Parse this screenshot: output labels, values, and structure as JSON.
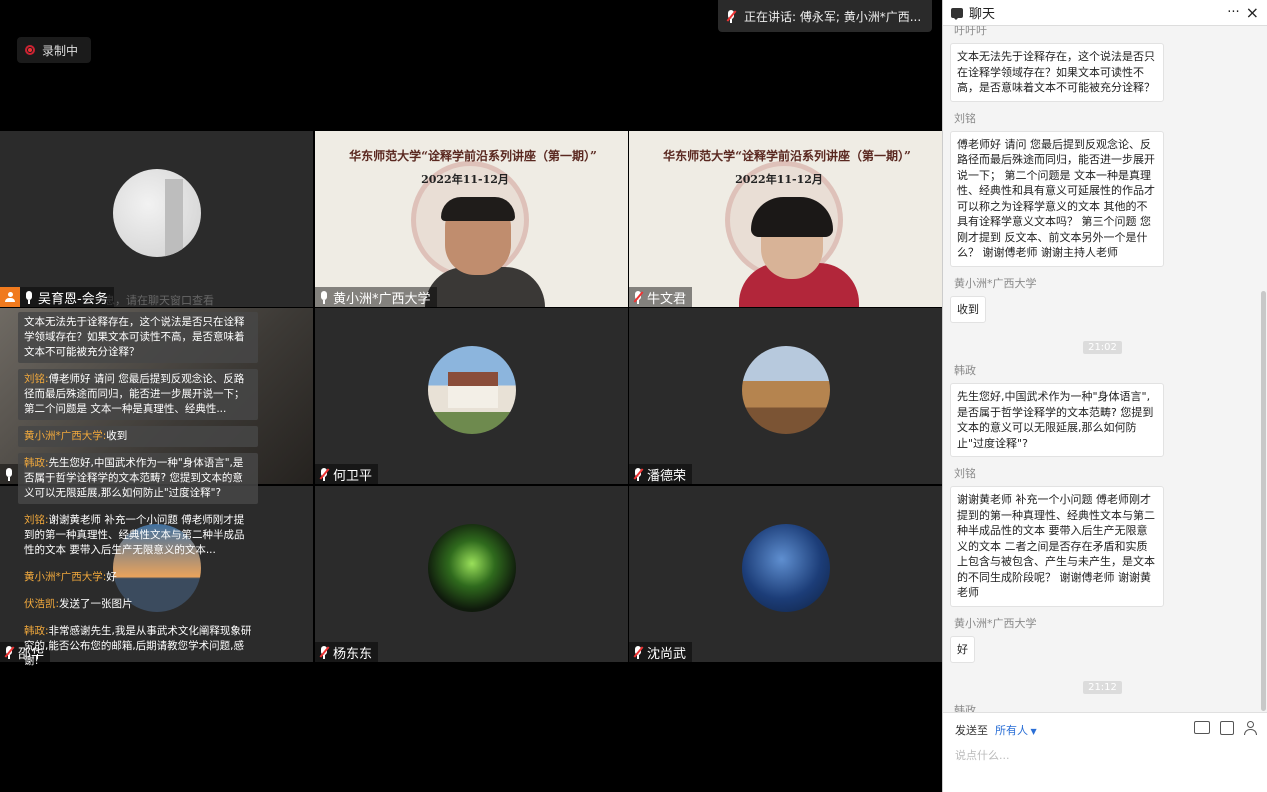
{
  "recording": {
    "label": "录制中"
  },
  "speaking": {
    "label": "正在讲话: 傅永军; 黄小洲*广西..."
  },
  "tiles": [
    {
      "name": "吴育恩-会务",
      "mic": "on",
      "host": true
    },
    {
      "name": "黄小洲*广西大学",
      "mic": "on"
    },
    {
      "name": "牛文君",
      "mic": "off"
    },
    {
      "name": "",
      "mic": "on"
    },
    {
      "name": "何卫平",
      "mic": "off"
    },
    {
      "name": "潘德荣",
      "mic": "off"
    },
    {
      "name": "邵华",
      "mic": "off"
    },
    {
      "name": "杨东东",
      "mic": "off"
    },
    {
      "name": "沈尚武",
      "mic": "off"
    }
  ],
  "slide": {
    "title": "华东师范大学“诠释学前沿系列讲座（第一期）”",
    "date": "2022年11-12月"
  },
  "tile1_hint": "息，请在聊天窗口查看",
  "overlay": [
    {
      "name": "",
      "text": "文本无法先于诠释存在，这个说法是否只在诠释学领域存在？如果文本可读性不高，是否意味着文本不可能被充分诠释？"
    },
    {
      "name": "刘铭:",
      "text": "傅老师好  请问 您最后提到反观念论、反路径而最后殊途而同归，能否进一步展开说一下；第二个问题是  文本一种是真理性、经典性..."
    },
    {
      "name": "黄小洲*广西大学:",
      "text": "收到"
    },
    {
      "name": "韩政:",
      "text": "先生您好,中国武术作为一种\"身体语言\",是否属于哲学诠释学的文本范畴? 您提到文本的意义可以无限延展,那么如何防止\"过度诠释\"?"
    },
    {
      "name": "刘铭:",
      "text": "谢谢黄老师  补充一个小问题  傅老师刚才提到的第一种真理性、经典性文本与第二种半成品性的文本  要带入后生产无限意义的文本..."
    },
    {
      "name": "黄小洲*广西大学:",
      "text": "好"
    },
    {
      "name": "伏浩凯:",
      "text": "发送了一张图片"
    },
    {
      "name": "韩政:",
      "text": "非常感谢先生,我是从事武术文化阐释现象研究的,能否公布您的邮箱,后期请教您学术问题,感谢!"
    }
  ],
  "chat": {
    "title": "聊天",
    "more": "···",
    "close": "×",
    "top_sender": "吁吁吁",
    "messages": [
      {
        "type": "msg",
        "text": "文本无法先于诠释存在，这个说法是否只在诠释学领域存在？如果文本可读性不高，是否意味着文本不可能被充分诠释？"
      },
      {
        "type": "msg",
        "sender": "刘铭",
        "text": "傅老师好  请问 您最后提到反观念论、反路径而最后殊途而同归，能否进一步展开说一下；  第二个问题是  文本一种是真理性、经典性和具有意义可延展性的作品才可以称之为诠释学意义的文本  其他的不具有诠释学意义文本吗？  第三个问题  您刚才提到 反文本、前文本另外一个是什么？   谢谢傅老师  谢谢主持人老师"
      },
      {
        "type": "msg",
        "sender": "黄小洲*广西大学",
        "text": "收到"
      },
      {
        "type": "time",
        "text": "21:02"
      },
      {
        "type": "msg",
        "sender": "韩政",
        "text": "先生您好,中国武术作为一种\"身体语言\",是否属于哲学诠释学的文本范畴? 您提到文本的意义可以无限延展,那么如何防止\"过度诠释\"?"
      },
      {
        "type": "msg",
        "sender": "刘铭",
        "text": "谢谢黄老师  补充一个小问题  傅老师刚才提到的第一种真理性、经典性文本与第二种半成品性的文本  要带入后生产无限意义的文本  二者之间是否存在矛盾和实质上包含与被包含、产生与未产生，是文本的不同生成阶段呢？  谢谢傅老师   谢谢黄老师"
      },
      {
        "type": "msg",
        "sender": "黄小洲*广西大学",
        "text": "好"
      },
      {
        "type": "time",
        "text": "21:12"
      },
      {
        "type": "msg",
        "sender": "韩政",
        "text": "非常感谢先生,我是从事武术文化阐释现象研究的,能否公布您的邮箱,后期请教您学术问题,感谢!"
      }
    ],
    "send_to_label": "发送至",
    "send_to_value": "所有人",
    "input_placeholder": "说点什么..."
  }
}
